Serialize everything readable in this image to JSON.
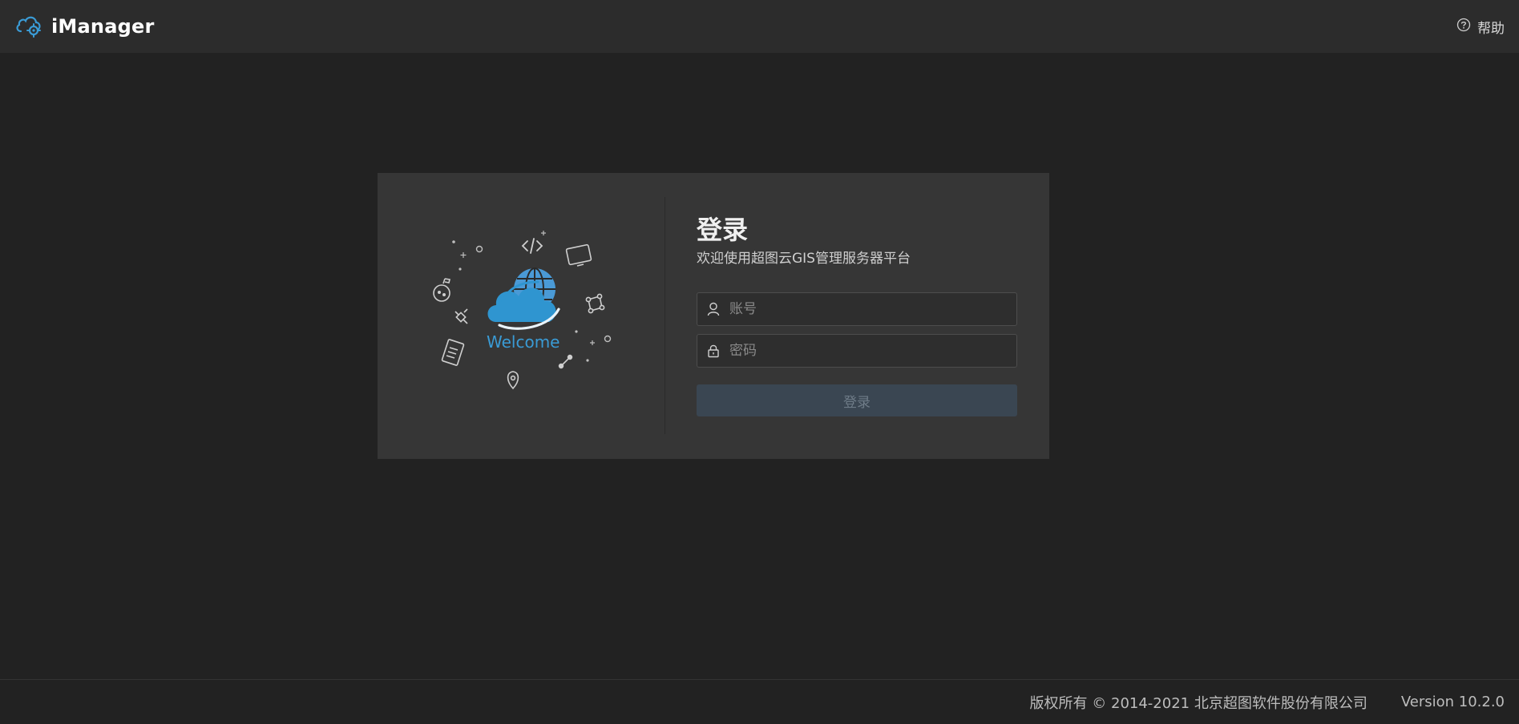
{
  "header": {
    "brand_name": "iManager",
    "help_label": "帮助"
  },
  "login": {
    "title": "登录",
    "subtitle": "欢迎使用超图云GIS管理服务器平台",
    "username_placeholder": "账号",
    "password_placeholder": "密码",
    "submit_label": "登录"
  },
  "illustration": {
    "welcome_text": "Welcome"
  },
  "footer": {
    "copyright": "版权所有 © 2014-2021 北京超图软件股份有限公司",
    "version": "Version 10.2.0"
  },
  "colors": {
    "accent": "#3a9bd5",
    "background": "#222222",
    "header": "#2c2c2c",
    "card": "#363636"
  }
}
